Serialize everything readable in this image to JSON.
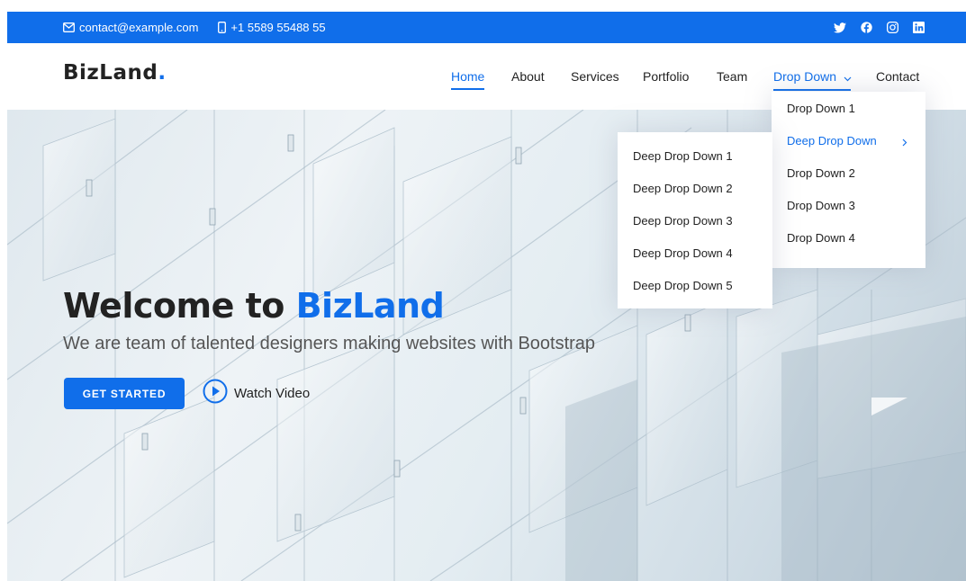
{
  "topbar": {
    "email": "contact@example.com",
    "phone": "+1 5589 55488 55",
    "social_icons": [
      "twitter-icon",
      "facebook-icon",
      "instagram-icon",
      "linkedin-icon"
    ],
    "bg_color": "#106eea"
  },
  "header": {
    "logo_text": "BizLand",
    "logo_dot": ".",
    "nav": [
      {
        "label": "Home",
        "active": true
      },
      {
        "label": "About"
      },
      {
        "label": "Services"
      },
      {
        "label": "Portfolio"
      },
      {
        "label": "Team"
      },
      {
        "label": "Drop Down",
        "open": true
      },
      {
        "label": "Contact"
      }
    ]
  },
  "dropdown": {
    "items": [
      "Drop Down 1",
      "Deep Drop Down",
      "Drop Down 2",
      "Drop Down 3",
      "Drop Down 4"
    ],
    "deep_items": [
      "Deep Drop Down 1",
      "Deep Drop Down 2",
      "Deep Drop Down 3",
      "Deep Drop Down 4",
      "Deep Drop Down 5"
    ]
  },
  "hero": {
    "title_prefix": "Welcome to ",
    "title_brand": "BizLand",
    "subtitle": "We are team of talented designers making websites with Bootstrap",
    "cta_label": "GET STARTED",
    "video_label": "Watch Video"
  },
  "colors": {
    "accent": "#106eea",
    "text": "#222222",
    "muted": "#555555"
  }
}
